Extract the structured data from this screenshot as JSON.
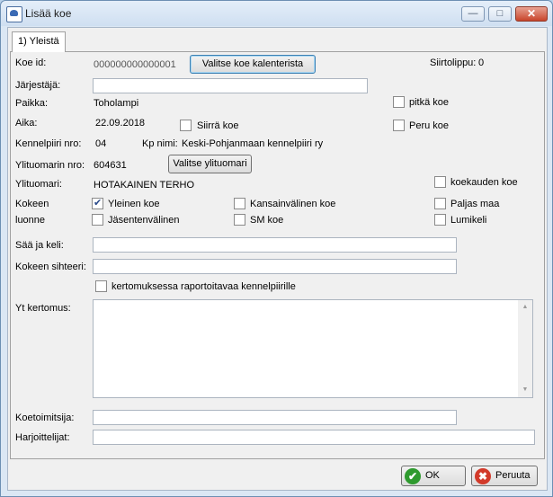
{
  "window": {
    "title": "Lisää koe",
    "minimize_glyph": "—",
    "maximize_glyph": "□",
    "close_glyph": "✕"
  },
  "tabs": [
    {
      "label": "1) Yleistä"
    }
  ],
  "form": {
    "koe_id_label": "Koe id:",
    "koe_id_value": "000000000000001",
    "valitse_kalenteri_label": "Valitse koe kalenterista",
    "siirtolippu_label": "Siirtolippu:",
    "siirtolippu_value": "0",
    "jarjestaja_label": "Järjestäjä:",
    "jarjestaja_value": "",
    "paikka_label": "Paikka:",
    "paikka_value": "Toholampi",
    "pitka_koe_label": "pitkä koe",
    "aika_label": "Aika:",
    "aika_value": "22.09.2018",
    "siirra_koe_label": "Siirrä koe",
    "peru_koe_label": "Peru koe",
    "kennelpiiri_label": "Kennelpiiri nro:",
    "kennelpiiri_value": "04",
    "kp_nimi_label": "Kp nimi:",
    "kp_nimi_value": "Keski-Pohjanmaan kennelpiiri ry",
    "ylituomari_nro_label": "Ylituomarin nro:",
    "ylituomari_nro_value": "604631",
    "valitse_ylituomari_label": "Valitse ylituomari",
    "ylituomari_label": "Ylituomari:",
    "ylituomari_value": "HOTAKAINEN TERHO",
    "koekauden_koe_label": "koekauden koe",
    "kokeen_luonne_label_1": "Kokeen",
    "kokeen_luonne_label_2": "luonne",
    "yleinen_koe_label": "Yleinen koe",
    "kansainvalinen_koe_label": "Kansainvälinen koe",
    "paljas_maa_label": "Paljas maa",
    "jasentenvalinen_label": "Jäsentenvälinen",
    "sm_koe_label": "SM koe",
    "lumikeli_label": "Lumikeli",
    "saa_ja_keli_label": "Sää ja keli:",
    "saa_ja_keli_value": "",
    "kokeen_sihteeri_label": "Kokeen sihteeri:",
    "kokeen_sihteeri_value": "",
    "kertomuksessa_label": "kertomuksessa raportoitavaa kennelpiirille",
    "yt_kertomus_label": "Yt kertomus:",
    "yt_kertomus_value": "",
    "koetoimitsija_label": "Koetoimitsija:",
    "koetoimitsija_value": "",
    "harjoittelijat_label": "Harjoittelijat:",
    "harjoittelijat_value": ""
  },
  "checkboxes": {
    "pitka_koe": false,
    "siirra_koe": false,
    "peru_koe": false,
    "koekauden_koe": false,
    "yleinen_koe": true,
    "kansainvalinen_koe": false,
    "paljas_maa": false,
    "jasentenvalinen": false,
    "sm_koe": false,
    "lumikeli": false,
    "kertomuksessa": false
  },
  "footer": {
    "ok_label": "OK",
    "peruuta_label": "Peruuta",
    "ok_icon_glyph": "✔",
    "peruuta_icon_glyph": "✖"
  },
  "colors": {
    "ok_icon": "#2e9a2e",
    "cancel_icon": "#d23a2a"
  }
}
